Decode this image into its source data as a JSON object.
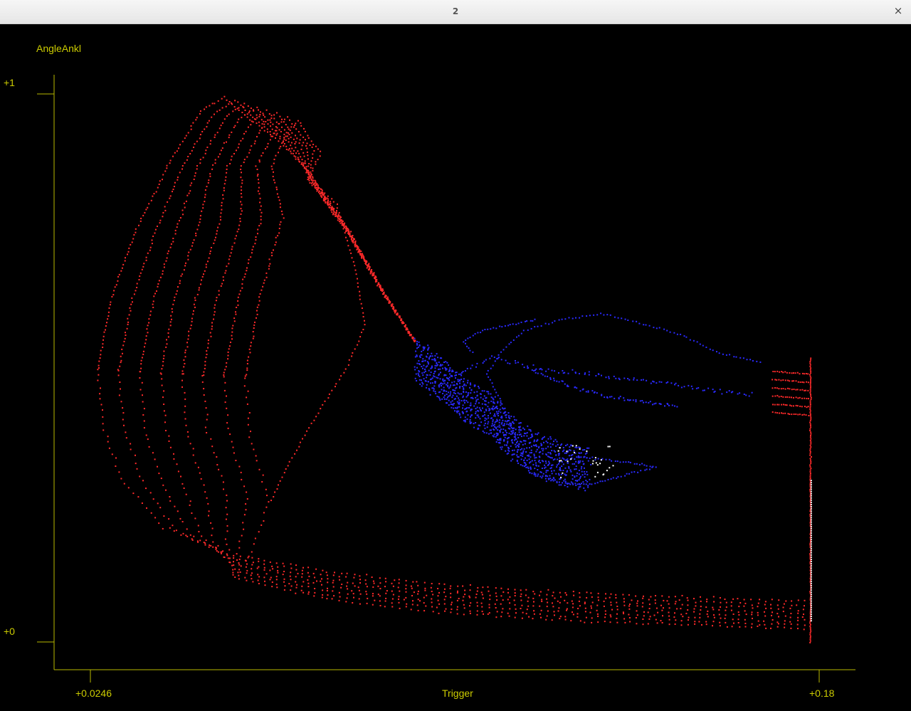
{
  "window": {
    "title": "2",
    "close_glyph": "×"
  },
  "colors": {
    "background": "#000000",
    "axis": "#b8b800",
    "label": "#cccc00",
    "series_red": "#ff2a2a",
    "series_blue": "#2a2aff",
    "series_white": "#ffffff"
  },
  "chart_data": {
    "type": "scatter",
    "ylabel": "AngleAnkl",
    "xlabel": "Trigger",
    "x_tick_labels": [
      "+0.0246",
      "+0.18"
    ],
    "y_tick_labels": [
      "+1",
      "+0"
    ],
    "xlim": [
      0.0246,
      0.18
    ],
    "ylim": [
      0,
      1
    ],
    "grid": false,
    "series": [
      {
        "color": "#ff2a2a",
        "description_points": [
          [
            0.0246,
            0.52
          ],
          [
            0.028,
            0.6
          ],
          [
            0.033,
            0.7
          ],
          [
            0.04,
            0.82
          ],
          [
            0.047,
            0.95
          ],
          [
            0.051,
            1.0
          ],
          [
            0.055,
            0.99
          ],
          [
            0.06,
            0.96
          ],
          [
            0.066,
            0.91
          ],
          [
            0.07,
            0.88
          ],
          [
            0.078,
            0.78
          ],
          [
            0.086,
            0.66
          ],
          [
            0.094,
            0.55
          ],
          [
            0.0246,
            0.42
          ],
          [
            0.03,
            0.28
          ],
          [
            0.04,
            0.18
          ],
          [
            0.06,
            0.12
          ],
          [
            0.08,
            0.09
          ],
          [
            0.1,
            0.07
          ],
          [
            0.12,
            0.06
          ],
          [
            0.14,
            0.05
          ],
          [
            0.16,
            0.04
          ],
          [
            0.178,
            0.03
          ]
        ]
      },
      {
        "color": "#2a2aff",
        "description_points": [
          [
            0.094,
            0.55
          ],
          [
            0.1,
            0.5
          ],
          [
            0.105,
            0.44
          ],
          [
            0.11,
            0.42
          ],
          [
            0.115,
            0.38
          ],
          [
            0.122,
            0.34
          ],
          [
            0.13,
            0.32
          ],
          [
            0.14,
            0.35
          ],
          [
            0.145,
            0.31
          ],
          [
            0.13,
            0.5
          ],
          [
            0.12,
            0.57
          ],
          [
            0.11,
            0.62
          ],
          [
            0.15,
            0.52
          ],
          [
            0.165,
            0.48
          ]
        ]
      }
    ]
  }
}
